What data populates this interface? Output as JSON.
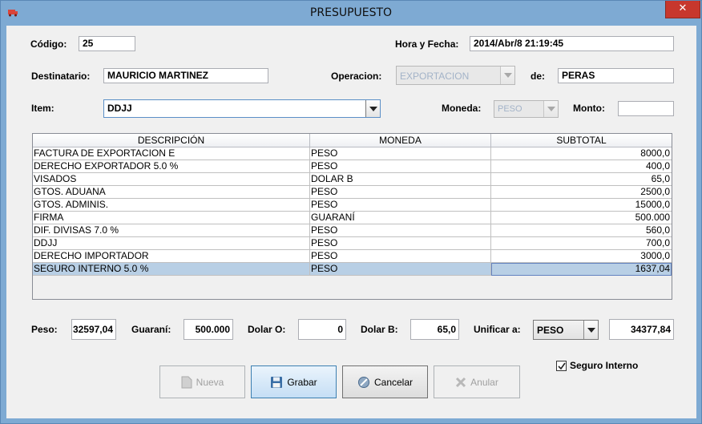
{
  "window": {
    "title": "PRESUPUESTO",
    "close_glyph": "✕"
  },
  "header": {
    "codigo_label": "Código:",
    "codigo_value": "25",
    "hora_label": "Hora y Fecha:",
    "hora_value": "2014/Abr/8 21:19:45",
    "destinatario_label": "Destinatario:",
    "destinatario_value": "MAURICIO MARTINEZ",
    "operacion_label": "Operacion:",
    "operacion_value": "EXPORTACION",
    "de_label": "de:",
    "de_value": "PERAS",
    "item_label": "Item:",
    "item_value": "DDJJ",
    "moneda_label": "Moneda:",
    "moneda_value": "PESO",
    "monto_label": "Monto:",
    "monto_value": ""
  },
  "table": {
    "columns": [
      "DESCRIPCIÓN",
      "MONEDA",
      "SUBTOTAL"
    ],
    "rows": [
      [
        "FACTURA DE EXPORTACION E",
        "PESO",
        "8000,0"
      ],
      [
        "DERECHO EXPORTADOR 5.0 %",
        "PESO",
        "400,0"
      ],
      [
        "VISADOS",
        "DOLAR B",
        "65,0"
      ],
      [
        "GTOS. ADUANA",
        "PESO",
        "2500,0"
      ],
      [
        "GTOS. ADMINIS.",
        "PESO",
        "15000,0"
      ],
      [
        "FIRMA",
        "GUARANÍ",
        "500.000"
      ],
      [
        "DIF. DIVISAS 7.0 %",
        "PESO",
        "560,0"
      ],
      [
        "DDJJ",
        "PESO",
        "700,0"
      ],
      [
        "DERECHO IMPORTADOR",
        "PESO",
        "3000,0"
      ],
      [
        "SEGURO INTERNO 5.0 %",
        "PESO",
        "1637,04"
      ]
    ],
    "selected_row": 9
  },
  "totals": {
    "peso_label": "Peso:",
    "peso_value": "32597,04",
    "guarani_label": "Guaraní:",
    "guarani_value": "500.000",
    "dolar_o_label": "Dolar O:",
    "dolar_o_value": "0",
    "dolar_b_label": "Dolar B:",
    "dolar_b_value": "65,0",
    "unificar_label": "Unificar a:",
    "unificar_value": "PESO",
    "total_value": "34377,84"
  },
  "seguro": {
    "label": "Seguro Interno",
    "checked": true
  },
  "buttons": {
    "nueva": "Nueva",
    "grabar": "Grabar",
    "cancelar": "Cancelar",
    "anular": "Anular"
  },
  "colors": {
    "frame": "#7eaad3",
    "close": "#c7372d",
    "selection": "#b8cfe5"
  }
}
